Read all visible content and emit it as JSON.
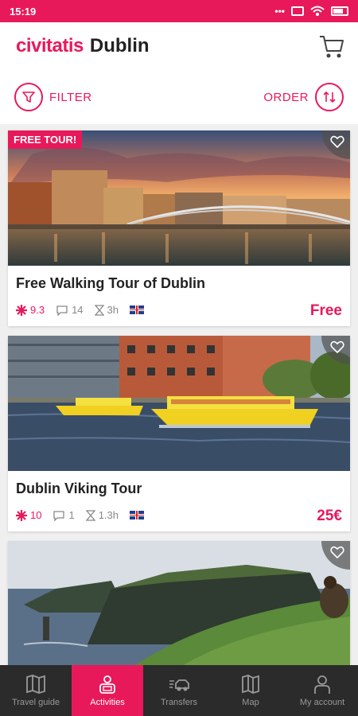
{
  "statusbar": {
    "time": "15:19"
  },
  "header": {
    "brand": "civitatis",
    "city": "Dublin",
    "filter_label": "FILTER",
    "order_label": "ORDER"
  },
  "cards": [
    {
      "badge": "FREE TOUR!",
      "title": "Free Walking Tour of Dublin",
      "rating": "9.3",
      "comments": "14",
      "duration": "3h",
      "price": "Free"
    },
    {
      "badge": "",
      "title": "Dublin Viking Tour",
      "rating": "10",
      "comments": "1",
      "duration": "1.3h",
      "price": "25€"
    },
    {
      "badge": "",
      "title": "",
      "rating": "",
      "comments": "",
      "duration": "",
      "price": ""
    }
  ],
  "nav": [
    {
      "label": "Travel guide",
      "icon": "map-book-icon"
    },
    {
      "label": "Activities",
      "icon": "activities-icon",
      "active": true
    },
    {
      "label": "Transfers",
      "icon": "car-icon"
    },
    {
      "label": "Map",
      "icon": "map-icon"
    },
    {
      "label": "My account",
      "icon": "user-icon"
    }
  ],
  "colors": {
    "accent": "#e8195a",
    "nav_bg": "#2b2b2b"
  }
}
